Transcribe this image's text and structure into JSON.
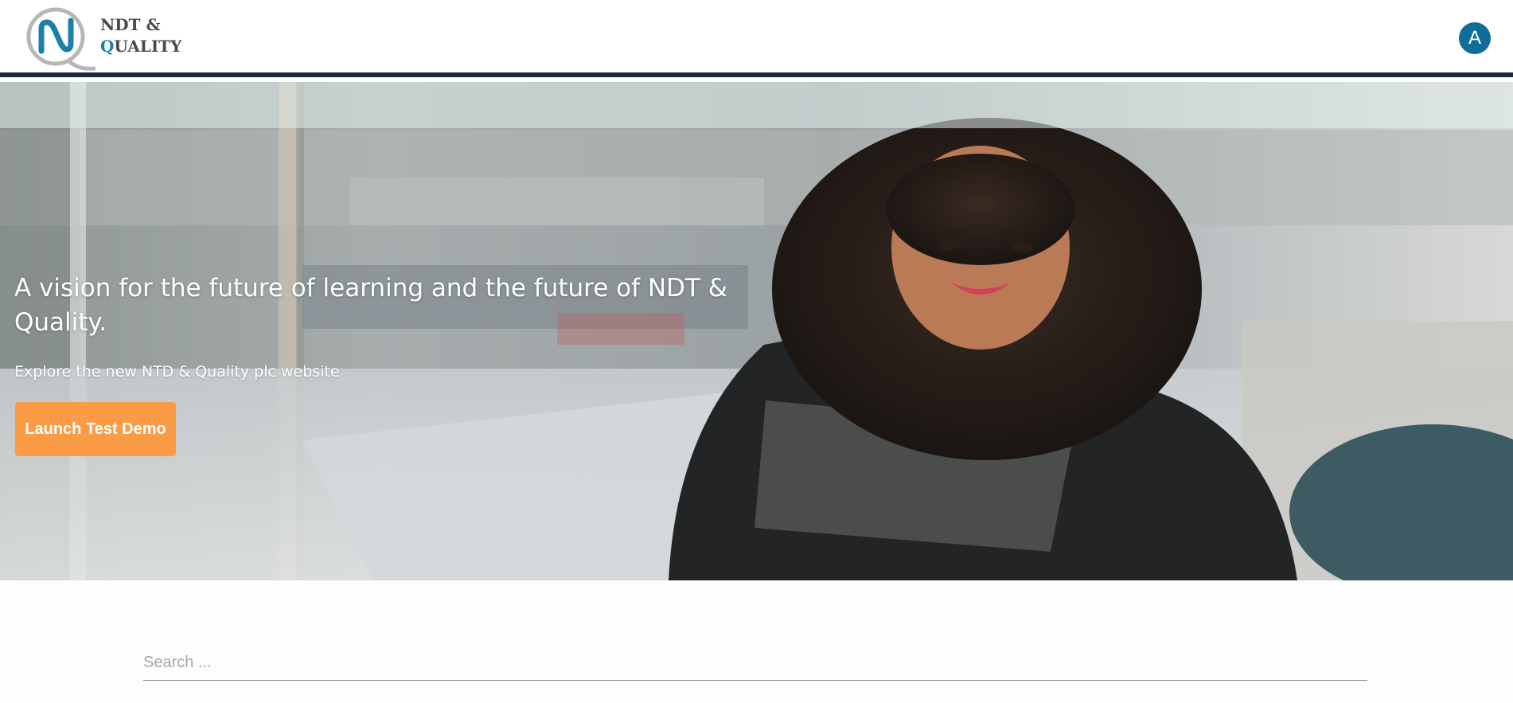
{
  "header": {
    "logo_line1": "NDT &",
    "logo_line2_accent": "Q",
    "logo_line2_rest": "UALITY",
    "avatar_initial": "A"
  },
  "hero": {
    "headline": "A vision for the future of learning and the future of NDT & Quality.",
    "subheadline": "Explore the new NTD & Quality plc website",
    "cta_label": "Launch Test Demo"
  },
  "search": {
    "placeholder": "Search ..."
  },
  "colors": {
    "brand_blue": "#1b7fa6",
    "avatar_bg": "#0f6d97",
    "header_rule": "#1c2a40",
    "cta_orange": "#fa9b45"
  },
  "icons": {
    "logo": "nq-monogram-icon",
    "avatar": "user-avatar"
  }
}
